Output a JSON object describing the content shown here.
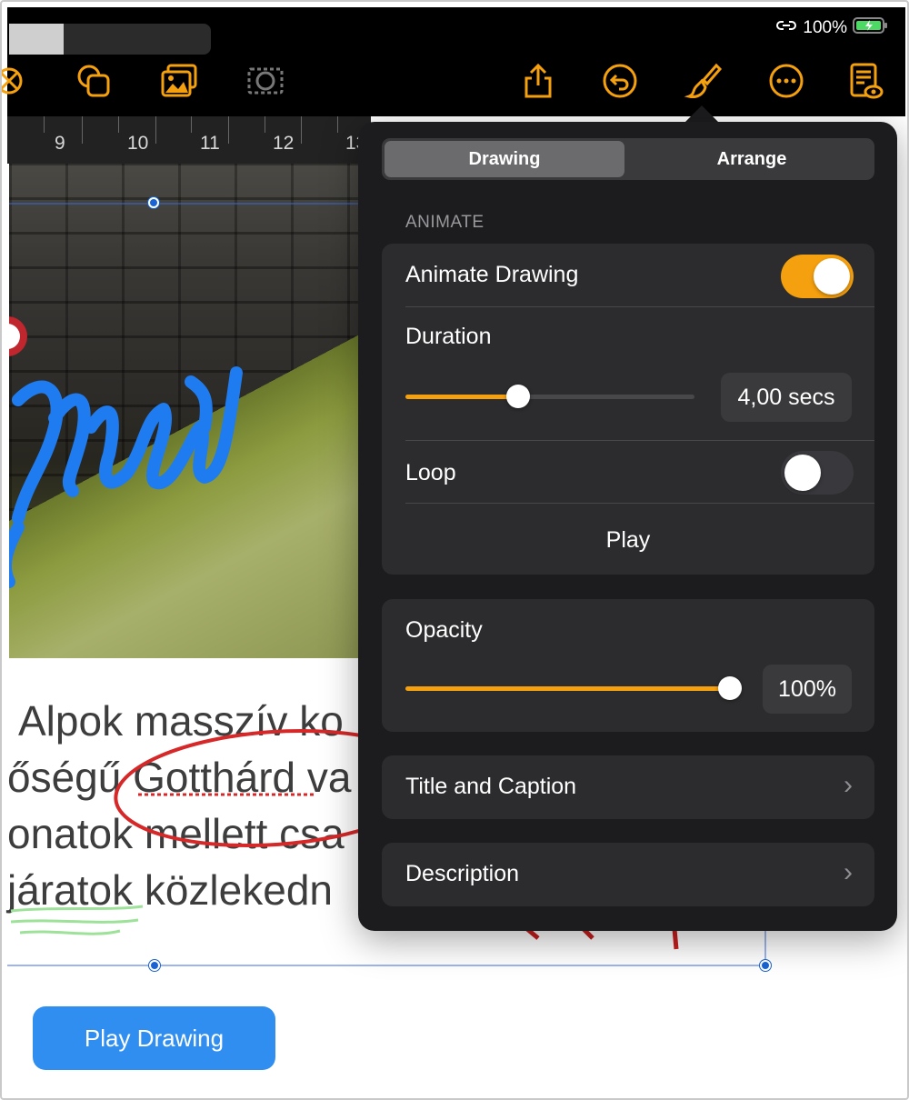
{
  "status_bar": {
    "battery_text": "100%"
  },
  "toolbar": {
    "accent_color": "#f5a00f",
    "icons": [
      "shapes-icon",
      "copy-icon",
      "photo-icon",
      "mask-icon",
      "share-icon",
      "undo-icon",
      "paintbrush-icon",
      "more-icon",
      "document-view-icon"
    ]
  },
  "ruler": {
    "numbers": [
      "9",
      "10",
      "11",
      "12",
      "13"
    ]
  },
  "document": {
    "lines": [
      "Alpok masszív ko",
      "őségű Gotthárd va",
      "onatok mellett csa",
      "járatok közlekedn"
    ]
  },
  "popover": {
    "tabs": [
      {
        "label": "Drawing",
        "selected": true
      },
      {
        "label": "Arrange",
        "selected": false
      }
    ],
    "animate_section": {
      "header": "ANIMATE",
      "animate_drawing": {
        "label": "Animate Drawing",
        "on": true
      },
      "duration": {
        "label": "Duration",
        "value_text": "4,00 secs",
        "slider_fraction": 0.39
      },
      "loop": {
        "label": "Loop",
        "on": false
      },
      "play_label": "Play"
    },
    "opacity": {
      "label": "Opacity",
      "value_text": "100%",
      "slider_fraction": 1.0
    },
    "title_and_caption": "Title and Caption",
    "description": "Description"
  },
  "play_drawing_button": "Play Drawing"
}
